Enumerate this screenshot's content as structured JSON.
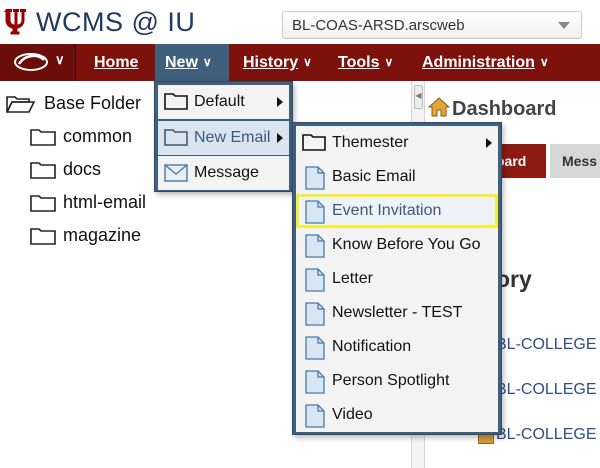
{
  "header": {
    "app_title": "WCMS @ IU",
    "site_selector_value": "BL-COAS-ARSD.arscweb"
  },
  "nav": {
    "items": [
      {
        "label": "Home",
        "has_menu": false
      },
      {
        "label": "New",
        "has_menu": true,
        "active": true
      },
      {
        "label": "History",
        "has_menu": true
      },
      {
        "label": "Tools",
        "has_menu": true
      },
      {
        "label": "Administration",
        "has_menu": true
      }
    ]
  },
  "tree": {
    "root": "Base Folder",
    "children": [
      "common",
      "docs",
      "html-email",
      "magazine"
    ]
  },
  "new_menu": {
    "items": [
      {
        "label": "Default",
        "icon": "folder-icon",
        "submenu": true
      },
      {
        "label": "New Email",
        "icon": "folder-icon",
        "submenu": true,
        "selected": true
      },
      {
        "label": "Message",
        "icon": "envelope-icon",
        "submenu": false
      }
    ]
  },
  "email_submenu": {
    "items": [
      {
        "label": "Themester",
        "icon": "folder-icon",
        "submenu": true
      },
      {
        "label": "Basic Email",
        "icon": "page-icon"
      },
      {
        "label": "Event Invitation",
        "icon": "page-icon",
        "highlighted": true
      },
      {
        "label": "Know Before You Go",
        "icon": "page-icon"
      },
      {
        "label": "Letter",
        "icon": "page-icon"
      },
      {
        "label": "Newsletter - TEST",
        "icon": "page-icon"
      },
      {
        "label": "Notification",
        "icon": "page-icon"
      },
      {
        "label": "Person Spotlight",
        "icon": "page-icon"
      },
      {
        "label": "Video",
        "icon": "page-icon"
      }
    ]
  },
  "dashboard": {
    "title": "Dashboard",
    "tab_dashboard_fragment": "oard",
    "tab_messages_fragment": "Mess",
    "history_fragment": "ory",
    "history_links": [
      "BL-COLLEGE",
      "BL-COLLEGE",
      "BL-COLLEGE"
    ]
  },
  "colors": {
    "nav_bg": "#7d110c",
    "menu_active": "#3f5f7d",
    "highlight": "#f4ee3a"
  }
}
